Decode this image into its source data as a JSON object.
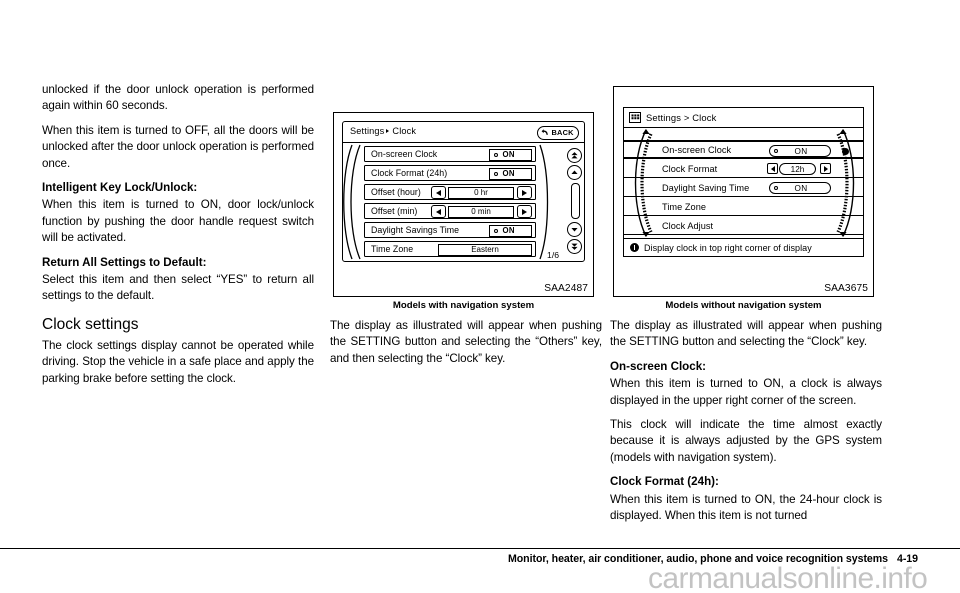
{
  "column1": {
    "paragraphs": [
      "unlocked if the door unlock operation is performed again within 60 seconds.",
      "When this item is turned to OFF, all the doors will be unlocked after the door unlock operation is performed once."
    ],
    "subhead_key_lock": "Intelligent Key Lock/Unlock:",
    "para_key_lock": "When this item is turned to ON, door lock/unlock function by pushing the door handle request switch will be activated.",
    "subhead_return_default": "Return All Settings to Default:",
    "para_return_default": "Select this item and then select “YES” to return all settings to the default.",
    "section_clock_settings": "Clock settings",
    "para_clock_settings": "The clock settings display cannot be operated while driving. Stop the vehicle in a safe place and apply the parking brake before setting the clock."
  },
  "figure1": {
    "id": "SAA2487",
    "caption": "Models with navigation system",
    "screen": {
      "title_left": "Settings",
      "title_right": "Clock",
      "back_label": "BACK",
      "page_indicator": "1/6",
      "rows": [
        {
          "label": "On-screen Clock",
          "control": "toggle",
          "value": "ON"
        },
        {
          "label": "Clock Format (24h)",
          "control": "toggle",
          "value": "ON"
        },
        {
          "label": "Offset (hour)",
          "control": "stepper",
          "value": "0 hr"
        },
        {
          "label": "Offset (min)",
          "control": "stepper",
          "value": "0 min"
        },
        {
          "label": "Daylight Savings Time",
          "control": "toggle",
          "value": "ON"
        },
        {
          "label": "Time Zone",
          "control": "value",
          "value": "Eastern"
        }
      ]
    }
  },
  "figure2": {
    "id": "SAA3675",
    "caption": "Models without navigation system",
    "screen": {
      "title": "Settings > Clock",
      "info_text": "Display clock in top right corner of display",
      "rows": [
        {
          "label": "On-screen Clock",
          "control": "toggle",
          "value": "ON",
          "selected": true
        },
        {
          "label": "Clock Format",
          "control": "stepper",
          "value": "12h",
          "selected": false
        },
        {
          "label": "Daylight Saving Time",
          "control": "toggle",
          "value": "ON",
          "selected": false
        },
        {
          "label": "Time Zone",
          "control": "none",
          "value": "",
          "selected": false
        },
        {
          "label": "Clock Adjust",
          "control": "none",
          "value": "",
          "selected": false
        }
      ]
    }
  },
  "column2": {
    "para_display": "The display as illustrated will appear when pushing the SETTING button and selecting the “Others” key, and then selecting the “Clock” key."
  },
  "column3": {
    "para_display": "The display as illustrated will appear when pushing the SETTING button and selecting the “Clock” key.",
    "subhead_onscreen_clock": "On-screen Clock:",
    "para_onscreen_clock": "When this item is turned to ON, a clock is always displayed in the upper right corner of the screen.",
    "para_gps": "This clock will indicate the time almost exactly because it is always adjusted by the GPS system (models with navigation system).",
    "subhead_clock_format": "Clock Format (24h):",
    "para_clock_format": "When this item is turned to ON, the 24-hour clock is displayed. When this item is not turned"
  },
  "footer": {
    "title": "Monitor, heater, air conditioner, audio, phone and voice recognition systems",
    "page": "4-19",
    "watermark": "carmanualsonline.info"
  }
}
